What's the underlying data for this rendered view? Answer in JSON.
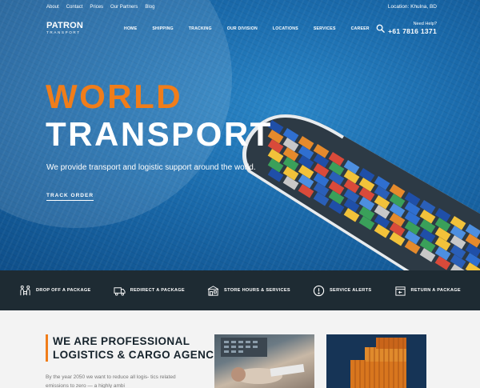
{
  "topbar": {
    "links": [
      "About",
      "Contact",
      "Prices",
      "Our Partners",
      "Blog"
    ],
    "location": "Location: Khulna, BD"
  },
  "logo": {
    "line1": "PATRON",
    "line2": "TRANSPORT"
  },
  "nav": {
    "items": [
      "HOME",
      "SHIPPING",
      "TRACKING",
      "OUR DIVISION",
      "LOCATIONS",
      "SERVICES",
      "CAREER"
    ]
  },
  "help": {
    "label": "Need Help?",
    "phone": "+61 7816 1371"
  },
  "hero": {
    "title_line1": "WORLD",
    "title_line2": "TRANSPORT",
    "subtitle": "We provide transport and logistic support around the world.",
    "cta": "TRACK ORDER"
  },
  "services": [
    {
      "label": "DROP OFF A PACKAGE",
      "icon": "people-package-icon"
    },
    {
      "label": "REDIRECT A PACKAGE",
      "icon": "truck-icon"
    },
    {
      "label": "STORE HOURS & SERVICES",
      "icon": "store-icon"
    },
    {
      "label": "SERVICE ALERTS",
      "icon": "alert-icon"
    },
    {
      "label": "RETURN A PACKAGE",
      "icon": "return-box-icon"
    }
  ],
  "about": {
    "heading_line1": "WE ARE PROFESSIONAL",
    "heading_line2": "LOGISTICS & CARGO AGENCY",
    "paragraph": "By the year 2050 we want to reduce all logis- tics related emissions to zero — a highly ambi"
  },
  "colors": {
    "accent": "#f07d1a",
    "dark": "#1e2b33",
    "heading": "#16232c",
    "sea": "#1a6aab"
  }
}
